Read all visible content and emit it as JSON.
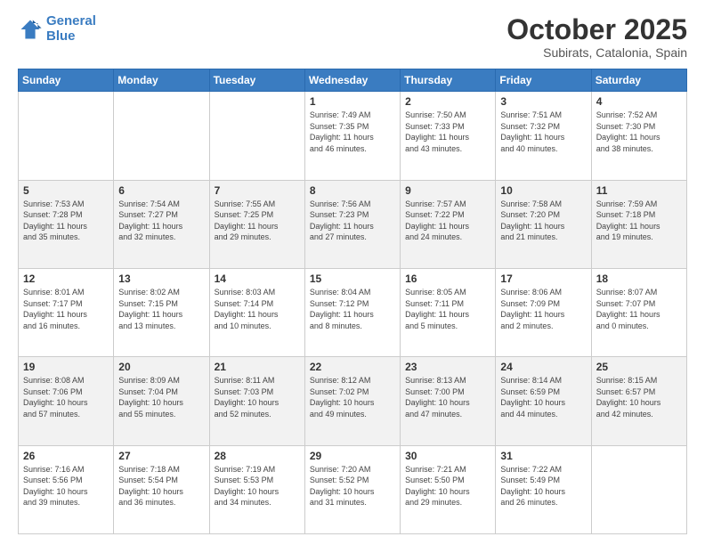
{
  "logo": {
    "line1": "General",
    "line2": "Blue"
  },
  "title": "October 2025",
  "subtitle": "Subirats, Catalonia, Spain",
  "days_of_week": [
    "Sunday",
    "Monday",
    "Tuesday",
    "Wednesday",
    "Thursday",
    "Friday",
    "Saturday"
  ],
  "weeks": [
    [
      {
        "day": "",
        "info": ""
      },
      {
        "day": "",
        "info": ""
      },
      {
        "day": "",
        "info": ""
      },
      {
        "day": "1",
        "info": "Sunrise: 7:49 AM\nSunset: 7:35 PM\nDaylight: 11 hours\nand 46 minutes."
      },
      {
        "day": "2",
        "info": "Sunrise: 7:50 AM\nSunset: 7:33 PM\nDaylight: 11 hours\nand 43 minutes."
      },
      {
        "day": "3",
        "info": "Sunrise: 7:51 AM\nSunset: 7:32 PM\nDaylight: 11 hours\nand 40 minutes."
      },
      {
        "day": "4",
        "info": "Sunrise: 7:52 AM\nSunset: 7:30 PM\nDaylight: 11 hours\nand 38 minutes."
      }
    ],
    [
      {
        "day": "5",
        "info": "Sunrise: 7:53 AM\nSunset: 7:28 PM\nDaylight: 11 hours\nand 35 minutes."
      },
      {
        "day": "6",
        "info": "Sunrise: 7:54 AM\nSunset: 7:27 PM\nDaylight: 11 hours\nand 32 minutes."
      },
      {
        "day": "7",
        "info": "Sunrise: 7:55 AM\nSunset: 7:25 PM\nDaylight: 11 hours\nand 29 minutes."
      },
      {
        "day": "8",
        "info": "Sunrise: 7:56 AM\nSunset: 7:23 PM\nDaylight: 11 hours\nand 27 minutes."
      },
      {
        "day": "9",
        "info": "Sunrise: 7:57 AM\nSunset: 7:22 PM\nDaylight: 11 hours\nand 24 minutes."
      },
      {
        "day": "10",
        "info": "Sunrise: 7:58 AM\nSunset: 7:20 PM\nDaylight: 11 hours\nand 21 minutes."
      },
      {
        "day": "11",
        "info": "Sunrise: 7:59 AM\nSunset: 7:18 PM\nDaylight: 11 hours\nand 19 minutes."
      }
    ],
    [
      {
        "day": "12",
        "info": "Sunrise: 8:01 AM\nSunset: 7:17 PM\nDaylight: 11 hours\nand 16 minutes."
      },
      {
        "day": "13",
        "info": "Sunrise: 8:02 AM\nSunset: 7:15 PM\nDaylight: 11 hours\nand 13 minutes."
      },
      {
        "day": "14",
        "info": "Sunrise: 8:03 AM\nSunset: 7:14 PM\nDaylight: 11 hours\nand 10 minutes."
      },
      {
        "day": "15",
        "info": "Sunrise: 8:04 AM\nSunset: 7:12 PM\nDaylight: 11 hours\nand 8 minutes."
      },
      {
        "day": "16",
        "info": "Sunrise: 8:05 AM\nSunset: 7:11 PM\nDaylight: 11 hours\nand 5 minutes."
      },
      {
        "day": "17",
        "info": "Sunrise: 8:06 AM\nSunset: 7:09 PM\nDaylight: 11 hours\nand 2 minutes."
      },
      {
        "day": "18",
        "info": "Sunrise: 8:07 AM\nSunset: 7:07 PM\nDaylight: 11 hours\nand 0 minutes."
      }
    ],
    [
      {
        "day": "19",
        "info": "Sunrise: 8:08 AM\nSunset: 7:06 PM\nDaylight: 10 hours\nand 57 minutes."
      },
      {
        "day": "20",
        "info": "Sunrise: 8:09 AM\nSunset: 7:04 PM\nDaylight: 10 hours\nand 55 minutes."
      },
      {
        "day": "21",
        "info": "Sunrise: 8:11 AM\nSunset: 7:03 PM\nDaylight: 10 hours\nand 52 minutes."
      },
      {
        "day": "22",
        "info": "Sunrise: 8:12 AM\nSunset: 7:02 PM\nDaylight: 10 hours\nand 49 minutes."
      },
      {
        "day": "23",
        "info": "Sunrise: 8:13 AM\nSunset: 7:00 PM\nDaylight: 10 hours\nand 47 minutes."
      },
      {
        "day": "24",
        "info": "Sunrise: 8:14 AM\nSunset: 6:59 PM\nDaylight: 10 hours\nand 44 minutes."
      },
      {
        "day": "25",
        "info": "Sunrise: 8:15 AM\nSunset: 6:57 PM\nDaylight: 10 hours\nand 42 minutes."
      }
    ],
    [
      {
        "day": "26",
        "info": "Sunrise: 7:16 AM\nSunset: 5:56 PM\nDaylight: 10 hours\nand 39 minutes."
      },
      {
        "day": "27",
        "info": "Sunrise: 7:18 AM\nSunset: 5:54 PM\nDaylight: 10 hours\nand 36 minutes."
      },
      {
        "day": "28",
        "info": "Sunrise: 7:19 AM\nSunset: 5:53 PM\nDaylight: 10 hours\nand 34 minutes."
      },
      {
        "day": "29",
        "info": "Sunrise: 7:20 AM\nSunset: 5:52 PM\nDaylight: 10 hours\nand 31 minutes."
      },
      {
        "day": "30",
        "info": "Sunrise: 7:21 AM\nSunset: 5:50 PM\nDaylight: 10 hours\nand 29 minutes."
      },
      {
        "day": "31",
        "info": "Sunrise: 7:22 AM\nSunset: 5:49 PM\nDaylight: 10 hours\nand 26 minutes."
      },
      {
        "day": "",
        "info": ""
      }
    ]
  ]
}
